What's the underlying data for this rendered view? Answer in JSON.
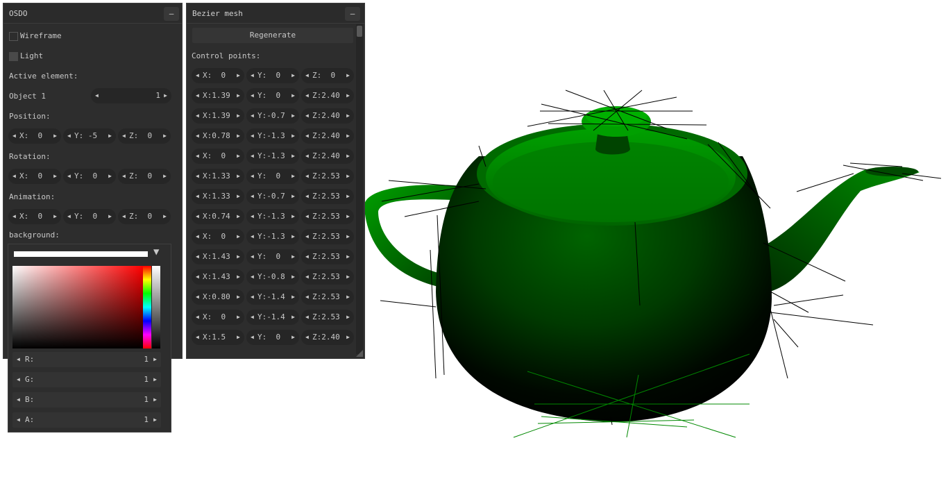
{
  "osdo": {
    "title": "OSDO",
    "minimize": "–",
    "wireframe": "Wireframe",
    "light": "Light",
    "active_element_label": "Active element:",
    "object_label": "Object 1",
    "object_index": "1",
    "position_label": "Position:",
    "position": [
      "X:  0",
      "Y: -5",
      "Z:  0"
    ],
    "rotation_label": "Rotation:",
    "rotation": [
      "X:  0",
      "Y:  0",
      "Z:  0"
    ],
    "animation_label": "Animation:",
    "animation": [
      "X:  0",
      "Y:  0",
      "Z:  0"
    ],
    "background_label": "background:",
    "dropdown_icon": "▼"
  },
  "colorpicker": {
    "channels": [
      {
        "label": "R:",
        "value": "1"
      },
      {
        "label": "G:",
        "value": "1"
      },
      {
        "label": "B:",
        "value": "1"
      },
      {
        "label": "A:",
        "value": "1"
      }
    ]
  },
  "bezier": {
    "title": "Bezier mesh",
    "minimize": "–",
    "regenerate": "Regenerate",
    "control_points_label": "Control points:",
    "rows": [
      [
        "X:  0",
        "Y:  0",
        "Z:  0"
      ],
      [
        "X:1.39",
        "Y:  0",
        "Z:2.40"
      ],
      [
        "X:1.39",
        "Y:-0.7",
        "Z:2.40"
      ],
      [
        "X:0.78",
        "Y:-1.3",
        "Z:2.40"
      ],
      [
        "X:  0",
        "Y:-1.3",
        "Z:2.40"
      ],
      [
        "X:1.33",
        "Y:  0",
        "Z:2.53"
      ],
      [
        "X:1.33",
        "Y:-0.7",
        "Z:2.53"
      ],
      [
        "X:0.74",
        "Y:-1.3",
        "Z:2.53"
      ],
      [
        "X:  0",
        "Y:-1.3",
        "Z:2.53"
      ],
      [
        "X:1.43",
        "Y:  0",
        "Z:2.53"
      ],
      [
        "X:1.43",
        "Y:-0.8",
        "Z:2.53"
      ],
      [
        "X:0.80",
        "Y:-1.4",
        "Z:2.53"
      ],
      [
        "X:  0",
        "Y:-1.4",
        "Z:2.53"
      ],
      [
        "X:1.5",
        "Y:  0",
        "Z:2.40"
      ]
    ]
  },
  "scene": {
    "background": "#ffffff",
    "mesh_color": "#007a00",
    "normal_color_dark": "#000000",
    "normal_color_green": "#008800"
  }
}
